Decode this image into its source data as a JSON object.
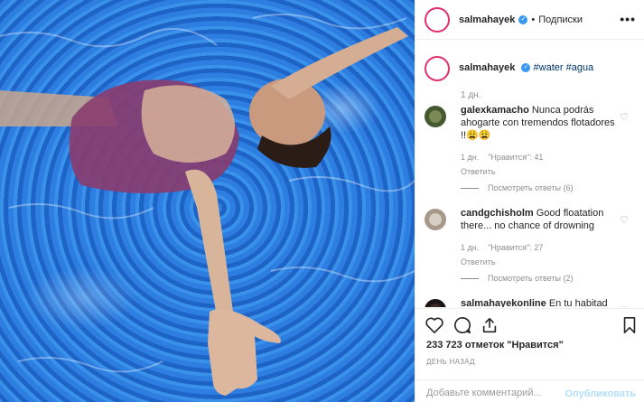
{
  "post": {
    "author": "salmahayek",
    "follow_label": "Подписки",
    "more_label": "•••",
    "caption_user": "salmahayek",
    "caption_text": "#water #agua",
    "caption_time": "1 дн.",
    "likes": "233 723 отметок \"Нравится\"",
    "timestamp": "ДЕНЬ НАЗАД"
  },
  "comments": [
    {
      "user": "galexkamacho",
      "text": "Nunca podrás ahogarte con tremendos flotadores !!😩😩",
      "time": "1 дн.",
      "likes": "\"Нравится\": 41",
      "reply": "Ответить",
      "view_replies": "Посмотреть ответы (6)"
    },
    {
      "user": "candgchisholm",
      "text": "Good floatation there... no chance of drowning",
      "time": "1 дн.",
      "likes": "\"Нравится\": 27",
      "reply": "Ответить",
      "view_replies": "Посмотреть ответы (2)"
    },
    {
      "user": "salmahayekonline",
      "text": "En tu habitad natural🔥👌"
    }
  ],
  "add_comment": {
    "placeholder": "Добавьте комментарий...",
    "publish": "Опубликовать"
  }
}
